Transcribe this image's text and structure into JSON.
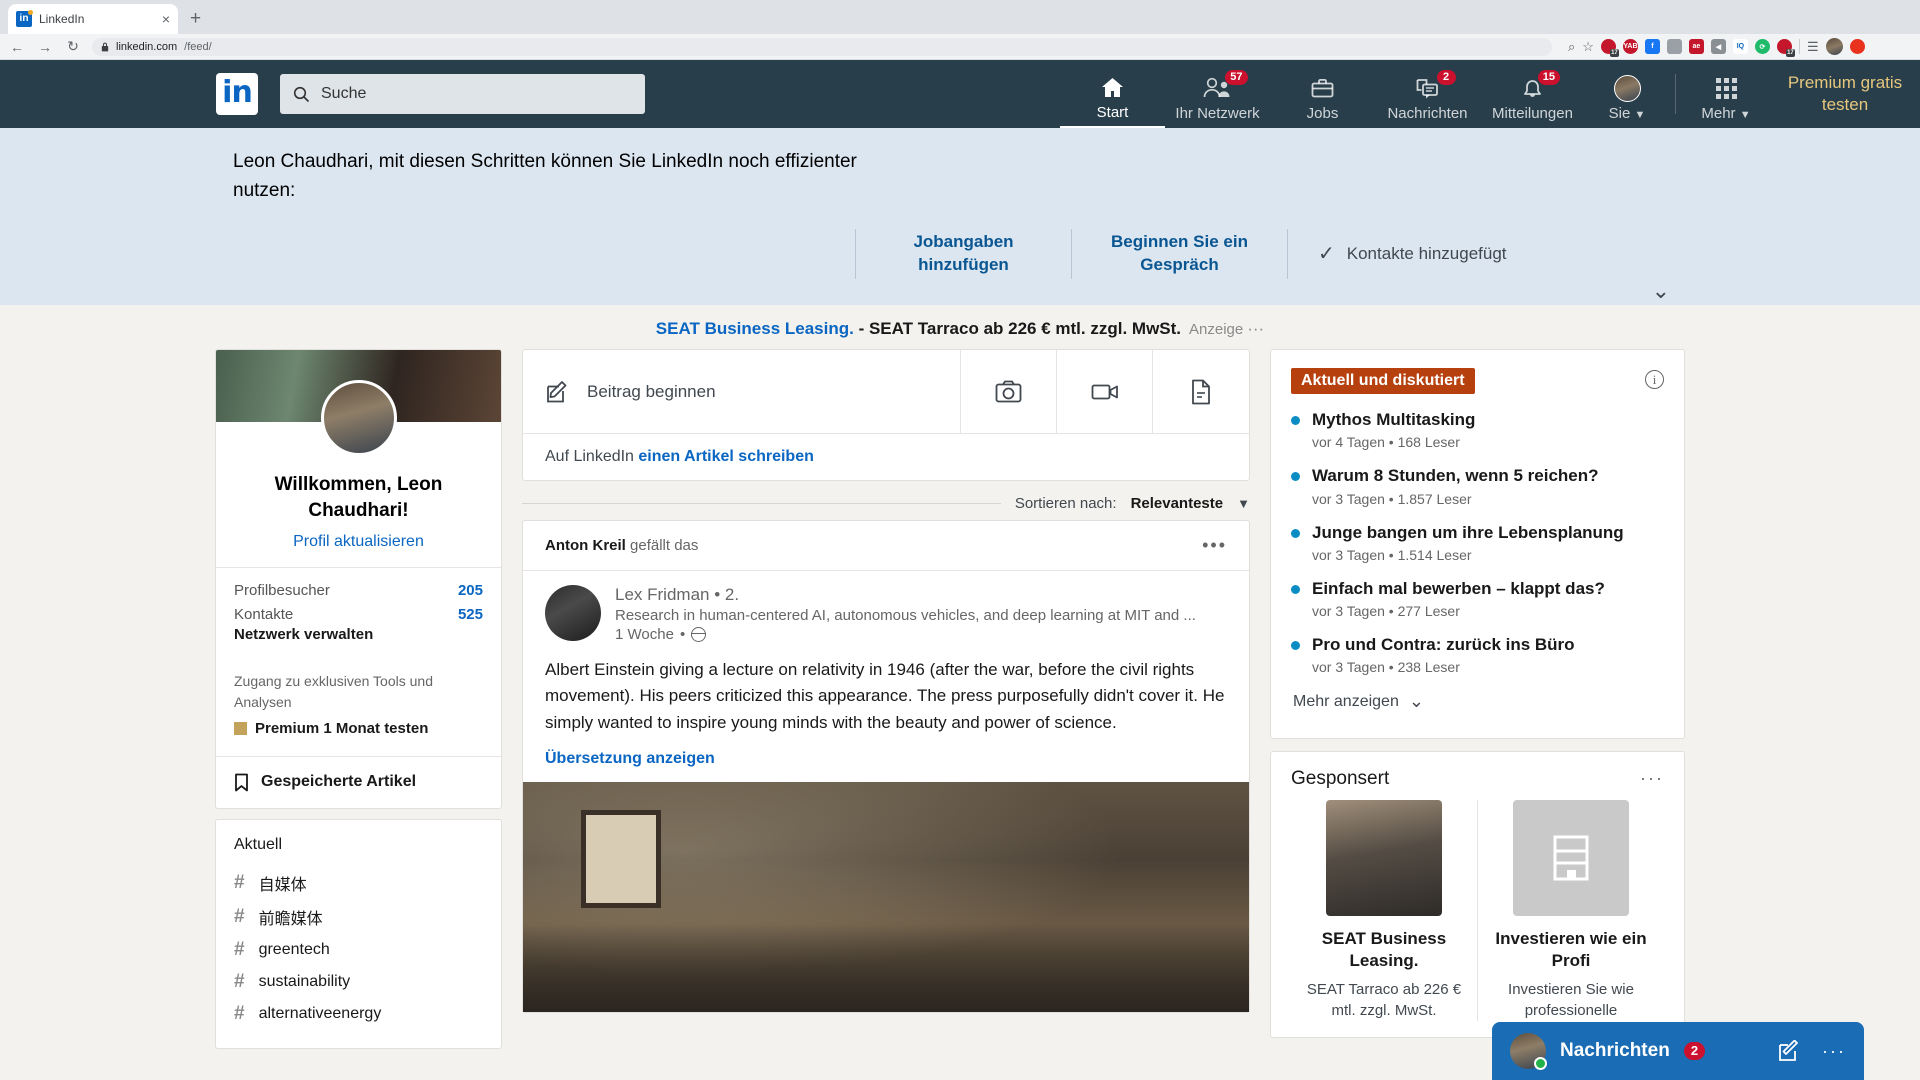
{
  "browser": {
    "tab": {
      "title": "LinkedIn",
      "favicon": "linkedin-favicon",
      "close": "×"
    },
    "newtab_label": "+",
    "nav": {
      "back": "←",
      "forward": "→",
      "reload": "↻"
    },
    "omnibox": {
      "lock": "🔒",
      "domain": "linkedin.com",
      "path": "/feed/"
    },
    "actions": {
      "zoom": "⌕",
      "bookmark": "☆"
    },
    "extensions": [
      {
        "name": "ext-calendar-red",
        "label": "",
        "color": "#c4172b",
        "badge": "17",
        "round": true
      },
      {
        "name": "ext-yab",
        "label": "YAB",
        "color": "#c4172b",
        "badge": "",
        "round": true
      },
      {
        "name": "ext-facebook",
        "label": "f",
        "color": "#1877f2",
        "badge": "",
        "round": false
      },
      {
        "name": "ext-grey-tool",
        "label": "",
        "color": "#9aa0a6",
        "badge": "",
        "round": false
      },
      {
        "name": "ext-ae",
        "label": "ae",
        "color": "#c4172b",
        "badge": "",
        "round": false
      },
      {
        "name": "ext-pocket",
        "label": "◀",
        "color": "#8a8f94",
        "badge": "",
        "round": false
      },
      {
        "name": "ext-iq",
        "label": "IQ",
        "color": "#0a66c2",
        "badge": "",
        "round": false
      },
      {
        "name": "ext-green-refresh",
        "label": "⟳",
        "color": "#1fbb6b",
        "badge": "",
        "round": true
      },
      {
        "name": "ext-alarm-red",
        "label": "",
        "color": "#c4172b",
        "badge": "17",
        "round": true
      }
    ],
    "reading_list": "☰",
    "profile": "browser-profile-avatar",
    "menu": "⬤"
  },
  "linkedin_nav": {
    "logo": "in",
    "search_placeholder": "Suche",
    "items": [
      {
        "name": "start",
        "label": "Start",
        "badge": "",
        "active": true
      },
      {
        "name": "network",
        "label": "Ihr Netzwerk",
        "badge": "57",
        "active": false
      },
      {
        "name": "jobs",
        "label": "Jobs",
        "badge": "",
        "active": false
      },
      {
        "name": "messaging",
        "label": "Nachrichten",
        "badge": "2",
        "active": false
      },
      {
        "name": "notifications",
        "label": "Mitteilungen",
        "badge": "15",
        "active": false
      }
    ],
    "me_label": "Sie",
    "more_label": "Mehr",
    "premium_label": "Premium gratis testen",
    "caret": "▼"
  },
  "banner": {
    "title": "Leon Chaudhari, mit diesen Schritten können Sie LinkedIn noch effizienter nutzen:",
    "collapse_icon": "⌄",
    "actions": [
      {
        "name": "add-job-details",
        "label": "Jobangaben hinzufügen",
        "done": false
      },
      {
        "name": "start-conversation",
        "label": "Beginnen Sie ein Gespräch",
        "done": false
      },
      {
        "name": "contacts-added",
        "label": "Kontakte hinzugefügt",
        "done": true,
        "check": "✓"
      }
    ]
  },
  "ad_strip": {
    "link": "SEAT Business Leasing.",
    "text": " - SEAT Tarraco ab 226 € mtl. zzgl. MwSt.",
    "tag": "Anzeige",
    "dots": "···"
  },
  "profile_card": {
    "greeting": "Willkommen, Leon Chaudhari!",
    "update_link": "Profil aktualisieren",
    "stats": [
      {
        "label": "Profilbesucher",
        "value": "205"
      },
      {
        "label": "Kontakte",
        "value": "525"
      }
    ],
    "manage_network": "Netzwerk verwalten",
    "premium_text": "Zugang zu exklusiven Tools und Analysen",
    "premium_cta": "Premium 1 Monat testen",
    "saved_articles": "Gespeicherte Artikel"
  },
  "hashtags": {
    "title": "Aktuell",
    "symbol": "#",
    "items": [
      {
        "label": "自媒体"
      },
      {
        "label": "前瞻媒体"
      },
      {
        "label": "greentech"
      },
      {
        "label": "sustainability"
      },
      {
        "label": "alternativeenergy"
      }
    ]
  },
  "composer": {
    "placeholder": "Beitrag beginnen",
    "photo_icon": "camera-icon",
    "video_icon": "video-icon",
    "document_icon": "document-icon",
    "article_prefix": "Auf LinkedIn ",
    "article_link": "einen Artikel schreiben"
  },
  "sort": {
    "label": "Sortieren nach:",
    "value": "Relevanteste",
    "caret": "▼"
  },
  "post": {
    "context_actor": "Anton Kreil",
    "context_text": " gefällt das",
    "menu": "•••",
    "author": "Lex Fridman",
    "degree": "• 2.",
    "headline": "Research in human-centered AI, autonomous vehicles, and deep learning at MIT and ...",
    "time": "1 Woche",
    "time_sep": "•",
    "visibility_icon": "globe-icon",
    "body": "Albert Einstein giving a lecture on relativity in 1946 (after the war, before the civil rights movement). His peers criticized this appearance. The press purposefully didn't cover it. He simply wanted to inspire young minds with the beauty and power of science.",
    "translate": "Übersetzung anzeigen",
    "image_alt": "einstein-lecture-photo"
  },
  "news": {
    "badge": "Aktuell und diskutiert",
    "info_icon": "i",
    "items": [
      {
        "headline": "Mythos Multitasking",
        "meta": "vor 4 Tagen • 168 Leser"
      },
      {
        "headline": "Warum 8 Stunden, wenn 5 reichen?",
        "meta": "vor 3 Tagen • 1.857 Leser"
      },
      {
        "headline": "Junge bangen um ihre Lebensplanung",
        "meta": "vor 3 Tagen • 1.514 Leser"
      },
      {
        "headline": "Einfach mal bewerben – klappt das?",
        "meta": "vor 3 Tagen • 277 Leser"
      },
      {
        "headline": "Pro und Contra: zurück ins Büro",
        "meta": "vor 3 Tagen • 238 Leser"
      }
    ],
    "more": "Mehr anzeigen",
    "more_caret": "⌄"
  },
  "sponsored": {
    "title": "Gesponsert",
    "menu": "···",
    "items": [
      {
        "name": "SEAT Business Leasing.",
        "desc": "SEAT Tarraco ab 226 € mtl. zzgl. MwSt.",
        "thumb": "seat-car-photo"
      },
      {
        "name": "Investieren wie ein Profi",
        "desc": "Investieren Sie wie professionelle",
        "thumb": "building-placeholder-icon"
      }
    ]
  },
  "messaging_bar": {
    "title": "Nachrichten",
    "badge": "2",
    "compose_icon": "compose-icon",
    "more_icon": "···",
    "online": true
  },
  "colors": {
    "linkedin_blue": "#0a66c2",
    "nav_bg": "#283e4a",
    "banner_bg": "#dce6f1",
    "badge_red": "#cb112d",
    "news_badge": "#b7410e",
    "premium_gold": "#e7c77e",
    "page_bg": "#f3f2ef"
  }
}
